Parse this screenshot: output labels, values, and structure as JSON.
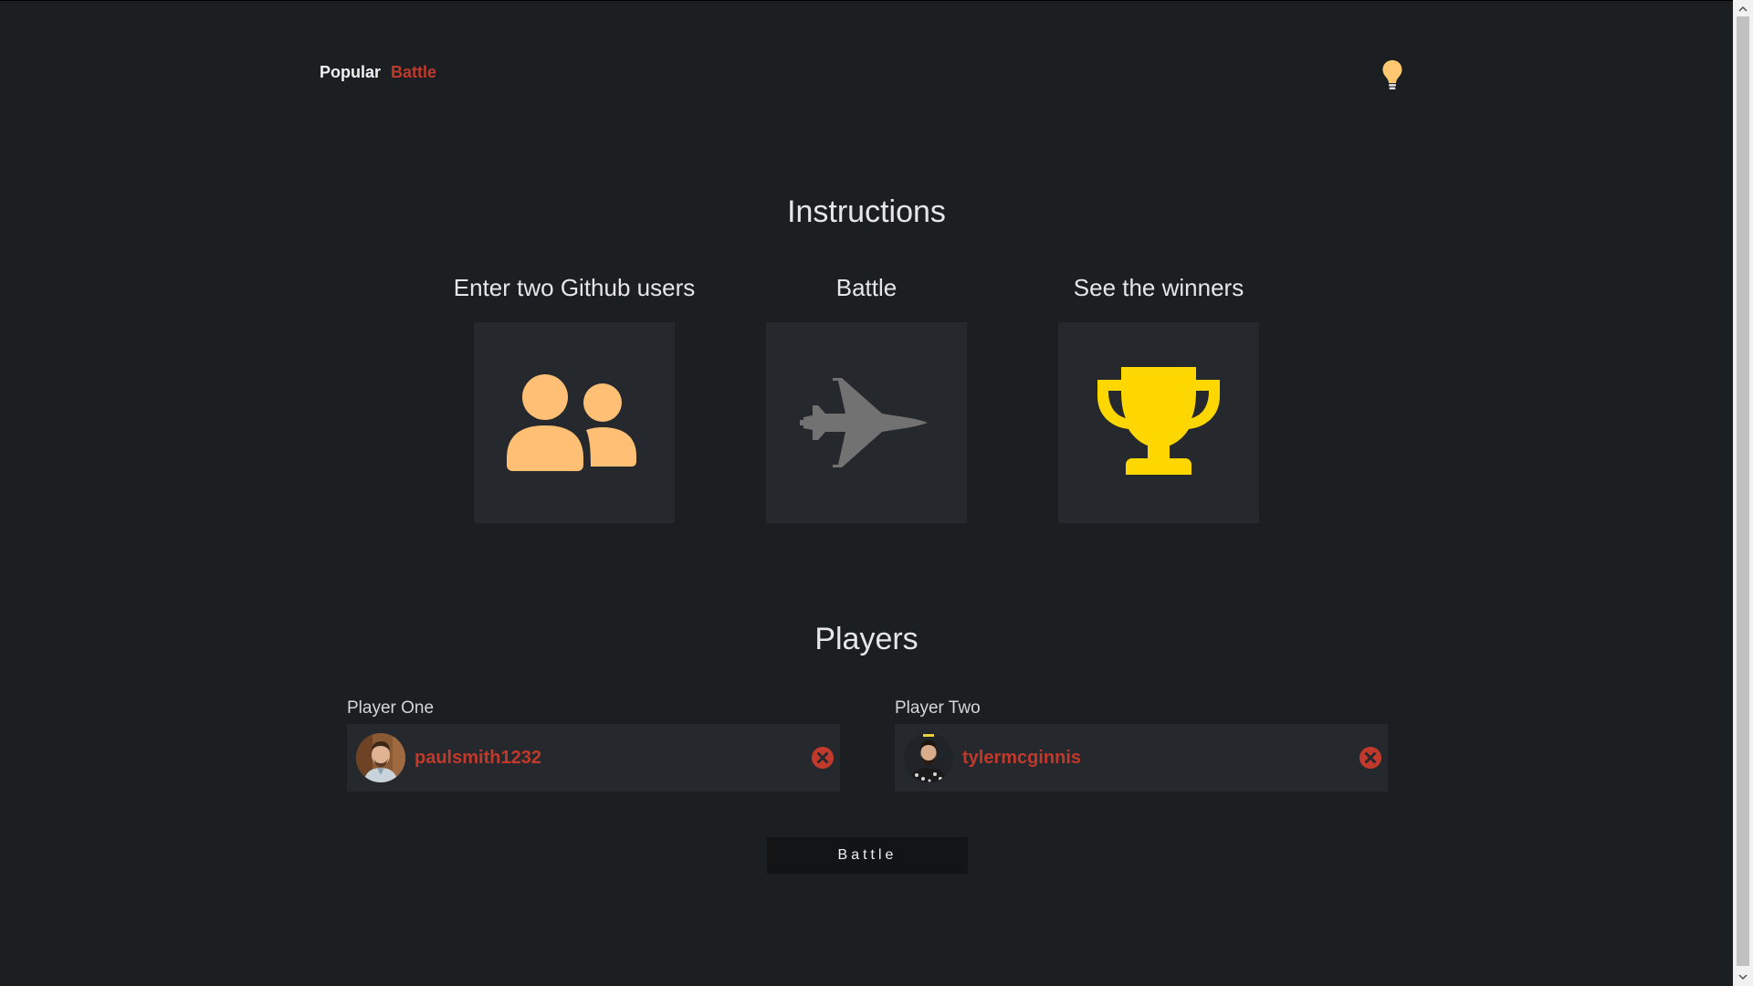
{
  "nav": {
    "items": [
      {
        "label": "Popular",
        "active": false
      },
      {
        "label": "Battle",
        "active": true
      }
    ],
    "theme_icon": "lightbulb-icon"
  },
  "instructions": {
    "title": "Instructions",
    "steps": [
      {
        "title": "Enter two Github users",
        "icon": "users-icon",
        "icon_color": "#ffbf74"
      },
      {
        "title": "Battle",
        "icon": "fighter-jet-icon",
        "icon_color": "#727272"
      },
      {
        "title": "See the winners",
        "icon": "trophy-icon",
        "icon_color": "#ffd700"
      }
    ]
  },
  "players": {
    "title": "Players",
    "player_one": {
      "label": "Player One",
      "username": "paulsmith1232"
    },
    "player_two": {
      "label": "Player Two",
      "username": "tylermcginnis"
    }
  },
  "battle_button": {
    "label": "Battle"
  },
  "colors": {
    "background": "#1c1f22",
    "card": "#25282c",
    "accent": "#c0392b"
  }
}
